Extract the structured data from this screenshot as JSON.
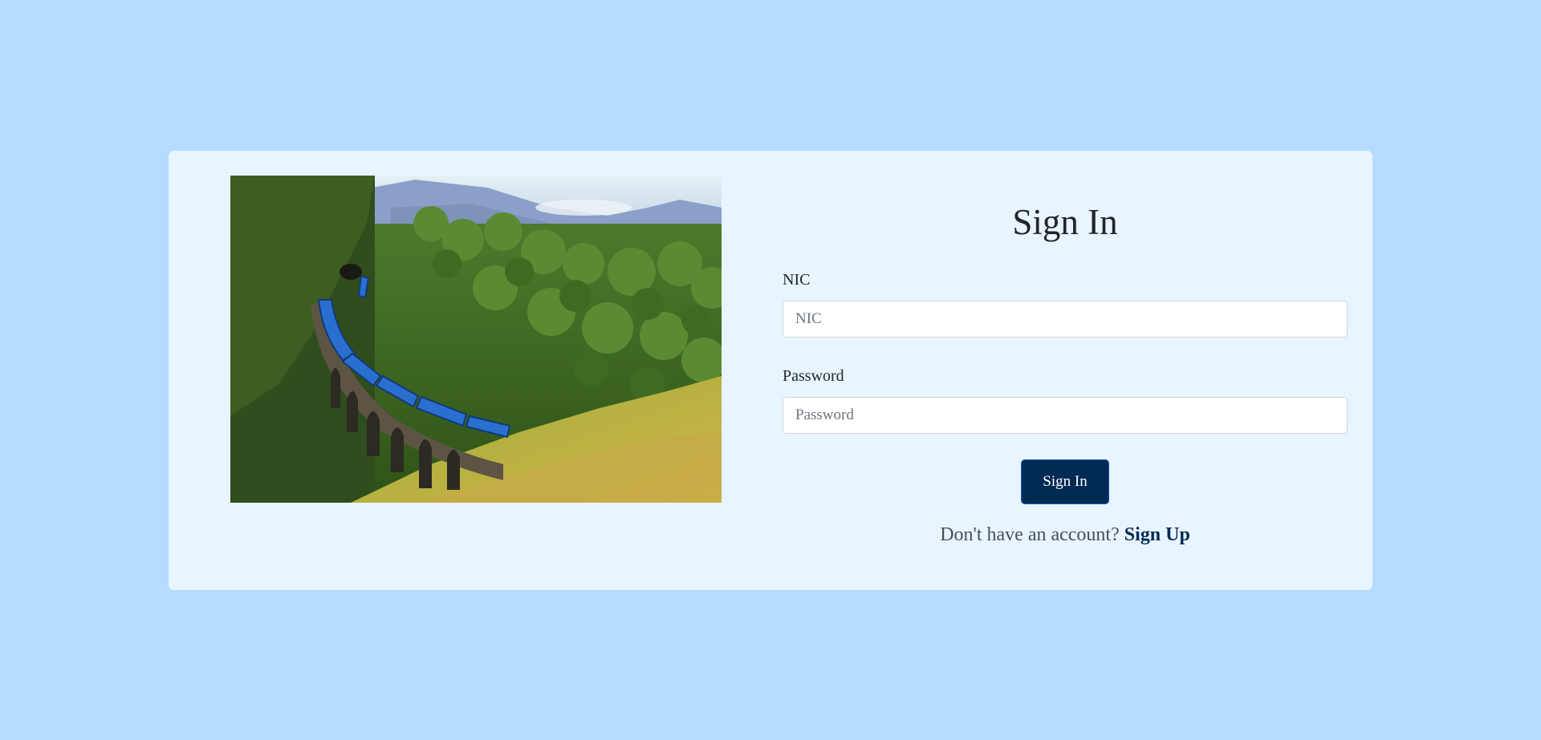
{
  "photo": {
    "subject": "blue-train-on-arched-bridge-through-jungle"
  },
  "form": {
    "title": "Sign In",
    "nic": {
      "label": "NIC",
      "placeholder": "NIC",
      "value": ""
    },
    "password": {
      "label": "Password",
      "placeholder": "Password",
      "value": ""
    },
    "submit_label": "Sign In",
    "signup_prompt": "Don't have an account?",
    "signup_link": "Sign Up"
  },
  "colors": {
    "page_background": "#b5dbff",
    "card_background": "#e8f4ff",
    "button_background": "#012a53",
    "link": "#012a53"
  }
}
